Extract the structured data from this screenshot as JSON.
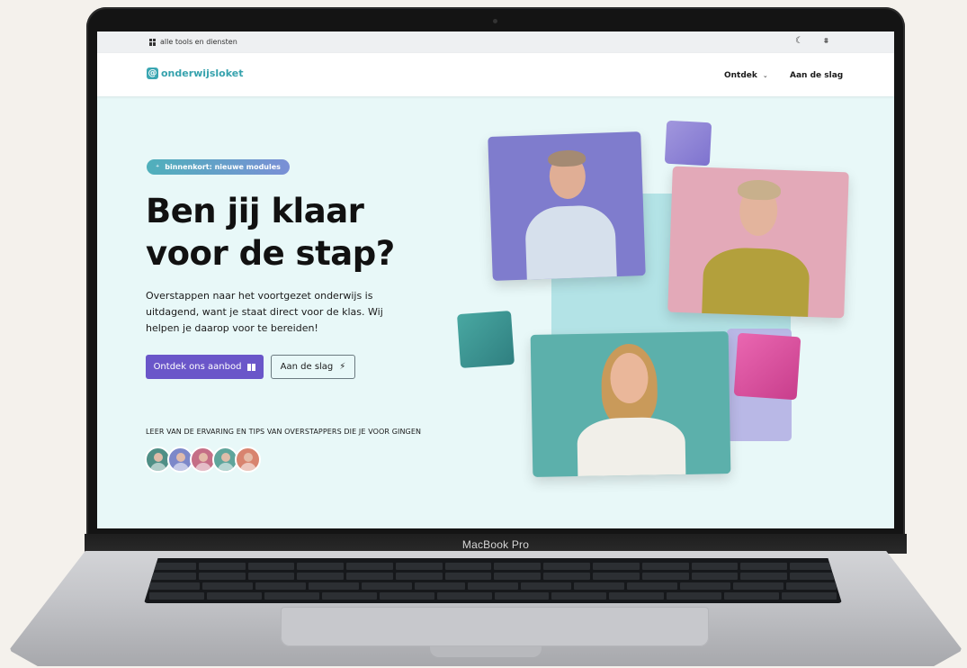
{
  "device_label": "MacBook Pro",
  "topbar": {
    "tools_label": "alle tools en diensten"
  },
  "navbar": {
    "logo_text": "onderwijsloket",
    "items": [
      {
        "label": "Ontdek"
      },
      {
        "label": "Aan de slag"
      }
    ]
  },
  "hero": {
    "badge": "binnenkort: nieuwe modules",
    "title_line1": "Ben jij klaar",
    "title_line2": "voor de stap?",
    "description": "Overstappen naar het voortgezet onderwijs is uitdagend, want je staat direct voor de klas. Wij helpen je daarop voor te bereiden!",
    "primary_button": "Ontdek ons aanbod",
    "secondary_button": "Aan de slag",
    "testimonial_label": "LEER VAN DE ERVARING EN TIPS VAN OVERSTAPPERS DIE JE VOOR GINGEN"
  },
  "colors": {
    "accent": "#6a56c9",
    "brand": "#36a2ad",
    "hero_bg": "#e8f8f8"
  },
  "avatars": [
    {
      "bg": "#4f8f86"
    },
    {
      "bg": "#7c88c9"
    },
    {
      "bg": "#c56e86"
    },
    {
      "bg": "#5fa59b"
    },
    {
      "bg": "#d8846f"
    }
  ]
}
